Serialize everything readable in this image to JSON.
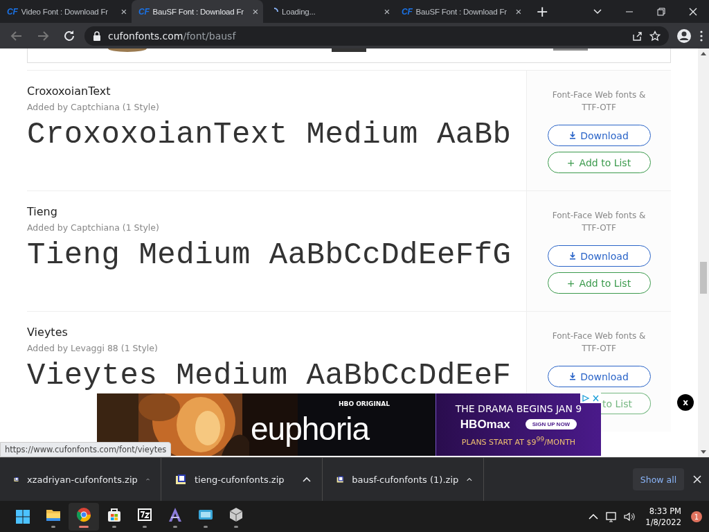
{
  "browser": {
    "tabs": [
      {
        "favicon": "CF",
        "title": "Video Font : Download Fr",
        "close": "×",
        "selected": false,
        "loading": false
      },
      {
        "favicon": "CF",
        "title": "BauSF Font : Download Fr",
        "close": "×",
        "selected": true,
        "loading": false
      },
      {
        "title": "Loading...",
        "close": "×",
        "selected": false,
        "loading": true
      },
      {
        "favicon": "CF",
        "title": "BauSF Font : Download Fr",
        "close": "×",
        "selected": false,
        "loading": false
      }
    ],
    "new_tab": "+",
    "url": {
      "domain": "cufonfonts.com",
      "path": "/font/bausf"
    }
  },
  "fonts": [
    {
      "name": "CroxoxoianText",
      "added_by": "Added by Captchiana (1 Style)",
      "preview": "CroxoxoianText Medium AaBb",
      "formats": "Font-Face Web fonts & TTF-OTF",
      "download": "Download",
      "add_icon": "+",
      "add": "Add to List",
      "covered": false
    },
    {
      "name": "Tieng",
      "added_by": "Added by Captchiana (1 Style)",
      "preview": "Tieng Medium AaBbCcDdEeFfG",
      "formats": "Font-Face Web fonts & TTF-OTF",
      "download": "Download",
      "add_icon": "+",
      "add": "Add to List",
      "covered": false
    },
    {
      "name": "Vieytes",
      "added_by": "Added by Levaggi 88 (1 Style)",
      "preview": "Vieytes Medium AaBbCcDdEeF",
      "formats": "Font-Face Web fonts & TTF-OTF",
      "download": "Download",
      "add": "to List",
      "covered": true
    }
  ],
  "ad": {
    "brand_tag": "HBO ORIGINAL",
    "show": "euphoria",
    "headline": "THE DRAMA BEGINS JAN 9",
    "service": "HBOmax",
    "cta": "SIGN UP NOW",
    "offer": "PLANS START AT $9$^{99}$/MONTH",
    "close": "x"
  },
  "status_url": "https://www.cufonfonts.com/font/vieytes",
  "downloads": {
    "files": [
      "xzadriyan-cufonfonts.zip",
      "tieng-cufonfonts.zip",
      "bausf-cufonfonts (1).zip"
    ],
    "show_all": "Show all"
  },
  "taskbar": {
    "apps": [
      {
        "kind": "start",
        "active": false
      },
      {
        "kind": "explorer",
        "active": false
      },
      {
        "kind": "chrome",
        "active": true
      },
      {
        "kind": "store",
        "active": false
      },
      {
        "kind": "archive",
        "active": false
      },
      {
        "kind": "font",
        "active": false
      },
      {
        "kind": "window",
        "active": false
      },
      {
        "kind": "cube",
        "active": false
      }
    ],
    "time": "8:33 PM",
    "date": "1/8/2022",
    "notifications": "1"
  }
}
